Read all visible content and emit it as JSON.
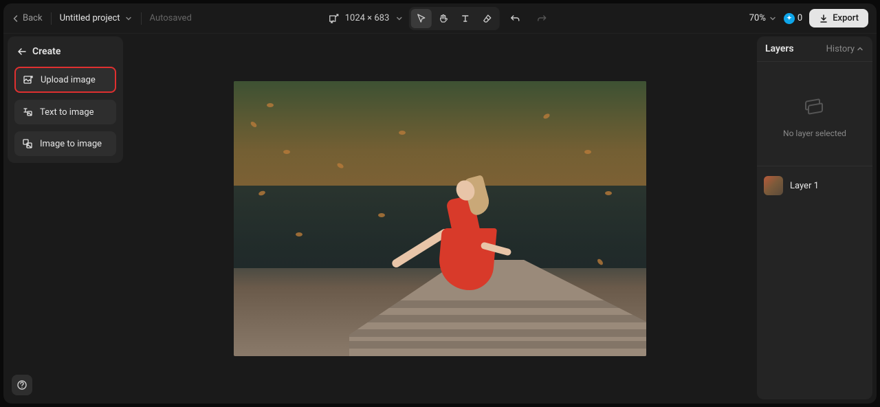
{
  "topbar": {
    "back": "Back",
    "project_name": "Untitled project",
    "autosaved": "Autosaved",
    "dimensions": "1024 × 683",
    "zoom": "70%",
    "credits": "0",
    "export": "Export"
  },
  "left_panel": {
    "title": "Create",
    "items": [
      {
        "label": "Upload image",
        "highlighted": true
      },
      {
        "label": "Text to image",
        "highlighted": false
      },
      {
        "label": "Image to image",
        "highlighted": false
      }
    ]
  },
  "right_panel": {
    "tab_layers": "Layers",
    "tab_history": "History",
    "no_layer_text": "No layer selected",
    "layers": [
      {
        "label": "Layer 1"
      }
    ]
  }
}
